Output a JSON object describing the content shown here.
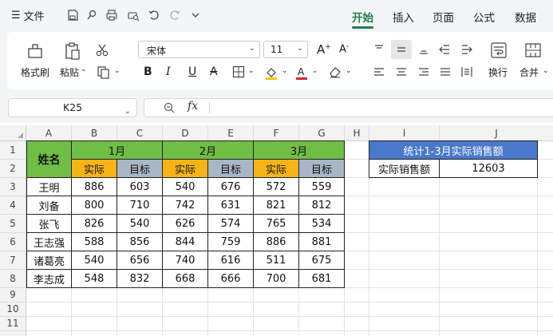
{
  "menu": {
    "file_label": "文件",
    "tabs": [
      {
        "label": "开始",
        "active": true
      },
      {
        "label": "插入",
        "active": false
      },
      {
        "label": "页面",
        "active": false
      },
      {
        "label": "公式",
        "active": false
      },
      {
        "label": "数据",
        "active": false
      }
    ]
  },
  "ribbon": {
    "format_painter_label": "格式刷",
    "paste_label": "粘贴",
    "font_name": "宋体",
    "font_size": "11",
    "wrap_label": "换行",
    "merge_label": "合并",
    "bold_glyph": "B",
    "italic_glyph": "I",
    "underline_glyph": "U",
    "strike_glyph": "A",
    "accent_color": "#1e7f4a",
    "fill_color": "#f7c500",
    "font_color": "#d62728"
  },
  "formula_bar": {
    "cell_ref": "K25",
    "fx_label": "fx",
    "formula": ""
  },
  "sheet": {
    "columns": [
      "A",
      "B",
      "C",
      "D",
      "E",
      "F",
      "G",
      "H",
      "I",
      "J"
    ],
    "rows": [
      "1",
      "2",
      "3",
      "4",
      "5",
      "6",
      "7",
      "8",
      "9",
      "10",
      "11"
    ],
    "name_header": "姓名",
    "months": [
      "1月",
      "2月",
      "3月"
    ],
    "sub_actual": "实际",
    "sub_target": "目标",
    "data": [
      {
        "name": "王明",
        "values": [
          "886",
          "603",
          "540",
          "676",
          "572",
          "559"
        ]
      },
      {
        "name": "刘备",
        "values": [
          "800",
          "710",
          "742",
          "631",
          "821",
          "812"
        ]
      },
      {
        "name": "张飞",
        "values": [
          "826",
          "540",
          "626",
          "574",
          "765",
          "534"
        ]
      },
      {
        "name": "王志强",
        "values": [
          "588",
          "856",
          "844",
          "759",
          "886",
          "881"
        ]
      },
      {
        "name": "诸葛亮",
        "values": [
          "540",
          "656",
          "740",
          "616",
          "511",
          "675"
        ]
      },
      {
        "name": "李志成",
        "values": [
          "548",
          "832",
          "668",
          "666",
          "700",
          "681"
        ]
      }
    ],
    "summary_title": "统计1-3月实际销售额",
    "summary_label": "实际销售额",
    "summary_value": "12603",
    "colors": {
      "green": "#6fbe45",
      "orange": "#f7b417",
      "gray": "#a9b6c7",
      "blue": "#4a78cc"
    }
  }
}
